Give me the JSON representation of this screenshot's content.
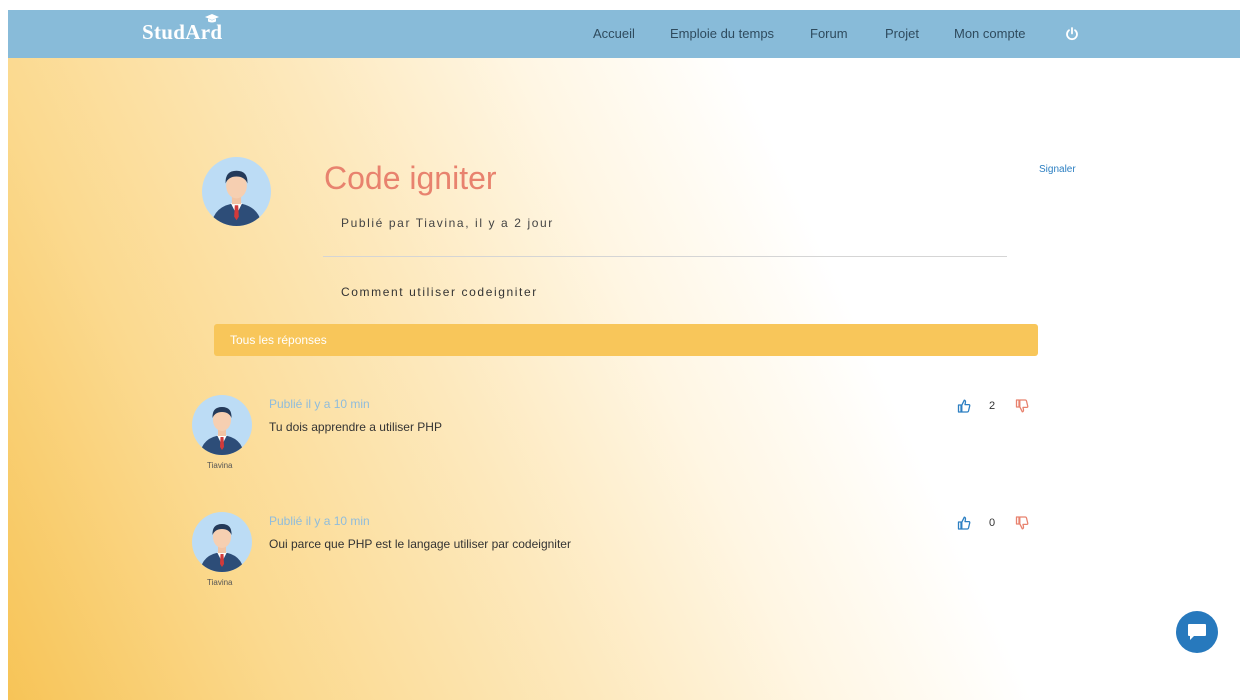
{
  "header": {
    "logo": "StudArd",
    "nav": [
      {
        "label": "Accueil"
      },
      {
        "label": "Emploie du temps"
      },
      {
        "label": "Forum"
      },
      {
        "label": "Projet"
      },
      {
        "label": "Mon compte"
      }
    ],
    "power_icon": "power-icon"
  },
  "post": {
    "title": "Code igniter",
    "meta": "Publié par Tiavina, il y a 2 jour",
    "report_label": "Signaler",
    "body": "Comment utiliser codeigniter"
  },
  "responses": {
    "header_label": "Tous les réponses",
    "items": [
      {
        "author": "Tiavina",
        "meta": "Publié il y a 10 min",
        "text": "Tu dois apprendre a utiliser PHP",
        "votes": "2"
      },
      {
        "author": "Tiavina",
        "meta": "Publié il y a 10 min",
        "text": "Oui parce que PHP est le langage utiliser par codeigniter",
        "votes": "0"
      }
    ]
  },
  "colors": {
    "navbar": "#88bbd9",
    "title": "#e8826e",
    "accent_bar": "#f8c65a",
    "link": "#2c7fc2",
    "like": "#2c7fc2",
    "dislike": "#e8826e",
    "chat": "#2779bd"
  },
  "icons": {
    "chat": "chat-bubble-icon",
    "like": "thumbs-up-icon",
    "dislike": "thumbs-down-icon",
    "avatar": "user-avatar-icon"
  }
}
